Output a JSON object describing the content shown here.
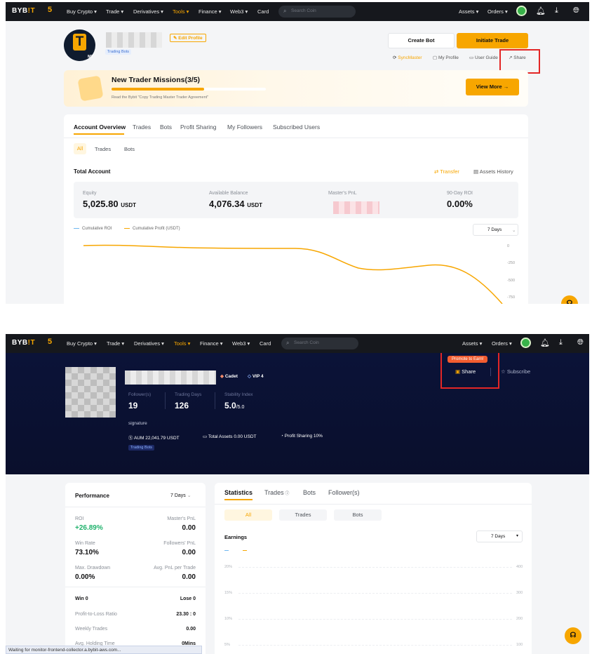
{
  "nav": {
    "logo": "BYB",
    "logo_accent": "!T",
    "five": "5",
    "items": [
      "Buy Crypto ▾",
      "Trade ▾",
      "Derivatives ▾",
      "Tools ▾",
      "Finance ▾",
      "Web3 ▾",
      "Card"
    ],
    "search_placeholder": "Search Coin",
    "assets": "Assets ▾",
    "orders": "Orders ▾"
  },
  "s1": {
    "avatar_letter": "T",
    "avatar_badge": "MY",
    "edit_profile": "Edit Profile",
    "trading_bots_tag": "Trading Bots",
    "create_bot": "Create Bot",
    "initiate_trade": "Initiate Trade",
    "links": [
      "SyncMaster",
      "My Profile",
      "User Guide",
      "Share"
    ],
    "mission_title": "New Trader Missions(3/5)",
    "mission_progress": 0.6,
    "mission_sub": "Read the Bybit \"Copy Trading Master Trader Agreement\"",
    "view_more": "View More",
    "tabs": [
      "Account Overview",
      "Trades",
      "Bots",
      "Profit Sharing",
      "My Followers",
      "Subscribed Users"
    ],
    "chips": [
      "All",
      "Trades",
      "Bots"
    ],
    "total_account": "Total Account",
    "transfer": "Transfer",
    "assets_history": "Assets History",
    "equity_label": "Equity",
    "equity_value": "5,025.80",
    "equity_unit": "USDT",
    "available_label": "Available Balance",
    "available_value": "4,076.34",
    "available_unit": "USDT",
    "masters_pnl_label": "Master's PnL",
    "roi90_label": "90-Day ROI",
    "roi90_value": "0.00%",
    "legend_roi": "Cumulative ROI",
    "legend_profit": "Cumulative Profit (USDT)",
    "days_select": "7 Days",
    "yaxis": [
      "0",
      "-250",
      "-500",
      "-750"
    ]
  },
  "s2": {
    "badge_cadet": "Cadet",
    "badge_vip": "VIP 4",
    "followers_label": "Follower(s)",
    "followers_value": "19",
    "trading_days_label": "Trading Days",
    "trading_days_value": "126",
    "stability_label": "Stability Index",
    "stability_value": "5.0",
    "stability_max": "/5.0",
    "signature": "signature",
    "aum": "AUM 22,041.79 USDT",
    "total_assets": "Total Assets 0.00 USDT",
    "profit_sharing": "Profit Sharing 10%",
    "trading_bots_tag": "Trading Bots",
    "promote": "Promote to Earn!",
    "share": "Share",
    "subscribe": "Subscribe",
    "performance": "Performance",
    "perf_days": "7 Days",
    "roi_label": "ROI",
    "roi_value": "+26.89%",
    "mpnl_label": "Master's PnL",
    "mpnl_value": "0.00",
    "winrate_label": "Win Rate",
    "winrate_value": "73.10%",
    "fpnl_label": "Followers' PnL",
    "fpnl_value": "0.00",
    "mdd_label": "Max. Drawdown",
    "mdd_value": "0.00%",
    "avgpnl_label": "Avg. PnL per Trade",
    "avgpnl_value": "0.00",
    "win": "Win 0",
    "lose": "Lose 0",
    "pl_ratio_label": "Profit-to-Loss Ratio",
    "pl_ratio_value": "23.30 : 0",
    "weekly_label": "Weekly Trades",
    "weekly_value": "0.00",
    "hold_label": "Avg. Holding Time",
    "hold_value": "0Mins",
    "tabs": [
      "Statistics",
      "Trades",
      "Bots",
      "Follower(s)"
    ],
    "chips": [
      "All",
      "Trades",
      "Bots"
    ],
    "earnings": "Earnings",
    "days_select": "7 Days",
    "left_axis": [
      "20%",
      "15%",
      "10%",
      "5%"
    ],
    "right_axis": [
      "400",
      "300",
      "200",
      "100"
    ],
    "status": "Waiting for monitor-frontend-collector.a.bybit-aws.com..."
  }
}
